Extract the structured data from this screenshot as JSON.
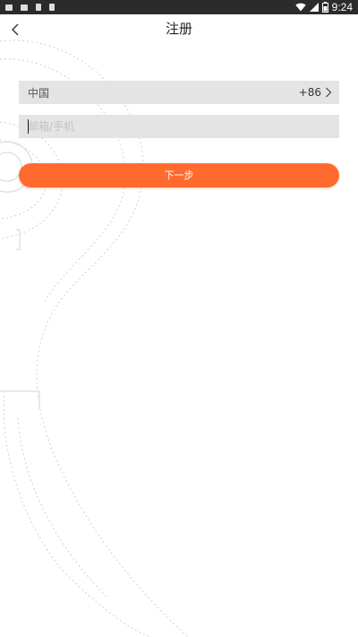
{
  "status_bar": {
    "time": "9:24",
    "icons": [
      "keyboard-icon",
      "message-icon",
      "download-icon",
      "app-icon",
      "wifi-icon",
      "cell-signal-icon",
      "battery-icon"
    ]
  },
  "header": {
    "title": "注册",
    "back_icon": "chevron-left-icon"
  },
  "form": {
    "country_name": "中国",
    "country_code": "+86",
    "account_input": {
      "value": "",
      "placeholder": "邮箱/手机"
    },
    "next_label": "下一步"
  },
  "colors": {
    "accent": "#ff6b2e",
    "field_bg": "#e4e4e4",
    "status_bar_bg": "#2b2b2b"
  }
}
